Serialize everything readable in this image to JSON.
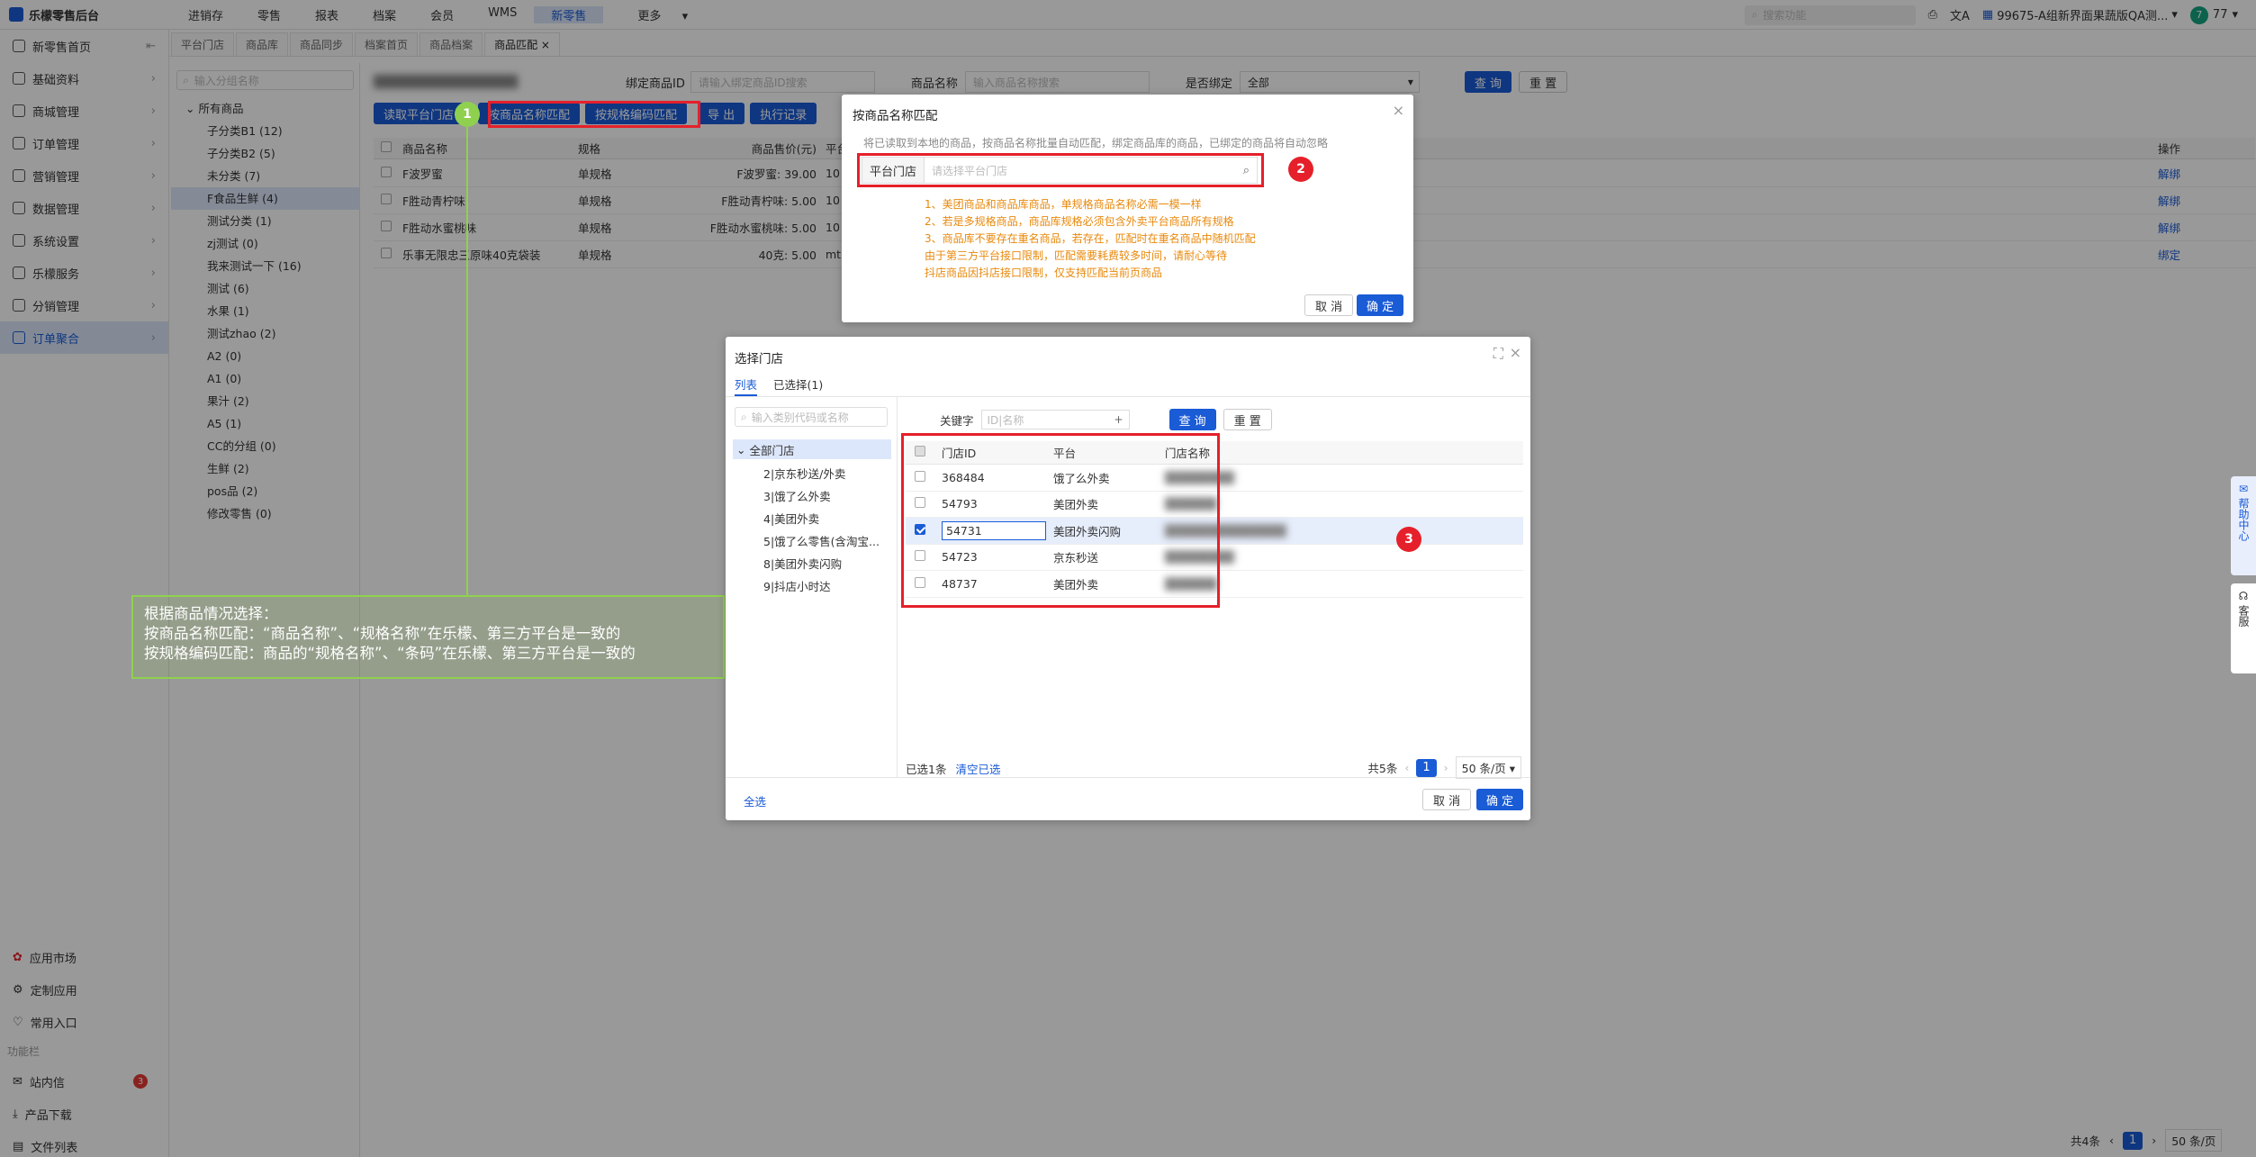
{
  "topbar": {
    "brand": "乐檬零售后台",
    "nav": [
      "进销存",
      "零售",
      "报表",
      "档案",
      "会员",
      "WMS",
      "新零售",
      "更多"
    ],
    "active_nav": "新零售",
    "search_placeholder": "搜索功能",
    "org": "99675-A组新界面果蔬版QA测...",
    "avatar_initial": "7",
    "user": "77"
  },
  "sidebar": {
    "items": [
      {
        "label": "新零售首页"
      },
      {
        "label": "基础资料"
      },
      {
        "label": "商城管理"
      },
      {
        "label": "订单管理"
      },
      {
        "label": "营销管理"
      },
      {
        "label": "数据管理"
      },
      {
        "label": "系统设置"
      },
      {
        "label": "乐檬服务"
      },
      {
        "label": "分销管理"
      },
      {
        "label": "订单聚合"
      }
    ],
    "active": "订单聚合",
    "bottom_items": [
      "应用市场",
      "定制应用",
      "常用入口"
    ],
    "section_label": "功能栏",
    "footer_items": [
      "站内信",
      "产品下载",
      "文件列表"
    ],
    "inbox_badge": "3"
  },
  "tabs": [
    "平台门店",
    "商品库",
    "商品同步",
    "档案首页",
    "商品档案",
    "商品匹配"
  ],
  "categories": {
    "search_placeholder": "输入分组名称",
    "root": "所有商品",
    "items": [
      "子分类B1 (12)",
      "子分类B2 (5)",
      "未分类 (7)",
      "F食品生鲜 (4)",
      "测试分类 (1)",
      "zj测试 (0)",
      "我来测试一下 (16)",
      "测试 (6)",
      "水果 (1)",
      "测试zhao (2)",
      "A2 (0)",
      "A1 (0)",
      "果汁 (2)",
      "A5 (1)",
      "CC的分组 (0)",
      "生鲜 (2)",
      "pos品 (2)",
      "修改零售 (0)"
    ],
    "selected": "F食品生鲜 (4)"
  },
  "filters": {
    "bind_id_label": "绑定商品ID",
    "bind_id_placeholder": "请输入绑定商品ID搜索",
    "name_label": "商品名称",
    "name_placeholder": "输入商品名称搜索",
    "bound_label": "是否绑定",
    "bound_value": "全部",
    "query": "查 询",
    "reset": "重 置"
  },
  "toolbar": [
    "读取平台门店",
    "按商品名称匹配",
    "按规格编码匹配",
    "导 出",
    "执行记录"
  ],
  "grid": {
    "headers": [
      "商品名称",
      "规格",
      "商品售价(元)",
      "平台",
      "操作"
    ],
    "rows": [
      {
        "name": "F波罗蜜",
        "spec": "单规格",
        "price": "F波罗蜜: 39.00",
        "platform": "10",
        "op": "解绑"
      },
      {
        "name": "F胜动青柠味",
        "spec": "单规格",
        "price": "F胜动青柠味: 5.00",
        "platform": "10",
        "op": "解绑"
      },
      {
        "name": "F胜动水蜜桃味",
        "spec": "单规格",
        "price": "F胜动水蜜桃味: 5.00",
        "platform": "10",
        "op": "解绑"
      },
      {
        "name": "乐事无限忠三原味40克袋装",
        "spec": "单规格",
        "price": "40克: 5.00",
        "platform": "mt",
        "op": "绑定"
      }
    ],
    "total": "共4条",
    "page": "1",
    "page_size": "50 条/页"
  },
  "match_dialog": {
    "title": "按商品名称匹配",
    "hint": "将已读取到本地的商品，按商品名称批量自动匹配，绑定商品库的商品，已绑定的商品将自动忽略",
    "field_label": "平台门店",
    "field_placeholder": "请选择平台门店",
    "rules": [
      "1、美团商品和商品库商品，单规格商品名称必需一模一样",
      "2、若是多规格商品，商品库规格必须包含外卖平台商品所有规格",
      "3、商品库不要存在重名商品，若存在，匹配时在重名商品中随机匹配",
      "由于第三方平台接口限制，匹配需要耗费较多时间，请耐心等待",
      "抖店商品因抖店接口限制，仅支持匹配当前页商品"
    ],
    "cancel": "取 消",
    "ok": "确 定",
    "badge": "2"
  },
  "store_dialog": {
    "title": "选择门店",
    "tabs": [
      "列表",
      "已选择(1)"
    ],
    "search_placeholder": "输入类别代码或名称",
    "tree_root": "全部门店",
    "tree_items": [
      "2|京东秒送/外卖",
      "3|饿了么外卖",
      "4|美团外卖",
      "5|饿了么零售(含淘宝...",
      "8|美团外卖闪购",
      "9|抖店小时达"
    ],
    "keyword_label": "关键字",
    "keyword_placeholder": "ID|名称",
    "query": "查 询",
    "reset": "重 置",
    "headers": [
      "门店ID",
      "平台",
      "门店名称"
    ],
    "rows": [
      {
        "id": "368484",
        "platform": "饿了么外卖",
        "name": "████████",
        "checked": false
      },
      {
        "id": "54793",
        "platform": "美团外卖",
        "name": "██████",
        "checked": false
      },
      {
        "id": "54731",
        "platform": "美团外卖闪购",
        "name": "██████████████",
        "checked": true
      },
      {
        "id": "54723",
        "platform": "京东秒送",
        "name": "████████",
        "checked": false
      },
      {
        "id": "48737",
        "platform": "美团外卖",
        "name": "██████",
        "checked": false
      }
    ],
    "selected_count": "已选1条",
    "clear": "清空已选",
    "total": "共5条",
    "page": "1",
    "page_size": "50 条/页",
    "select_all": "全选",
    "cancel": "取 消",
    "ok": "确 定",
    "badge": "3"
  },
  "annotation": {
    "badge": "1",
    "lines": [
      "根据商品情况选择：",
      "按商品名称匹配：“商品名称”、“规格名称”在乐檬、第三方平台是一致的",
      "按规格编码匹配：商品的“规格名称”、“条码”在乐檬、第三方平台是一致的"
    ]
  },
  "helper": {
    "help": "帮助中心",
    "service": "客服"
  },
  "colors": {
    "primary": "#1a5bd6",
    "annotation_red": "#e5202a",
    "annotation_green": "#8fd14f",
    "warning": "#e8890c"
  }
}
